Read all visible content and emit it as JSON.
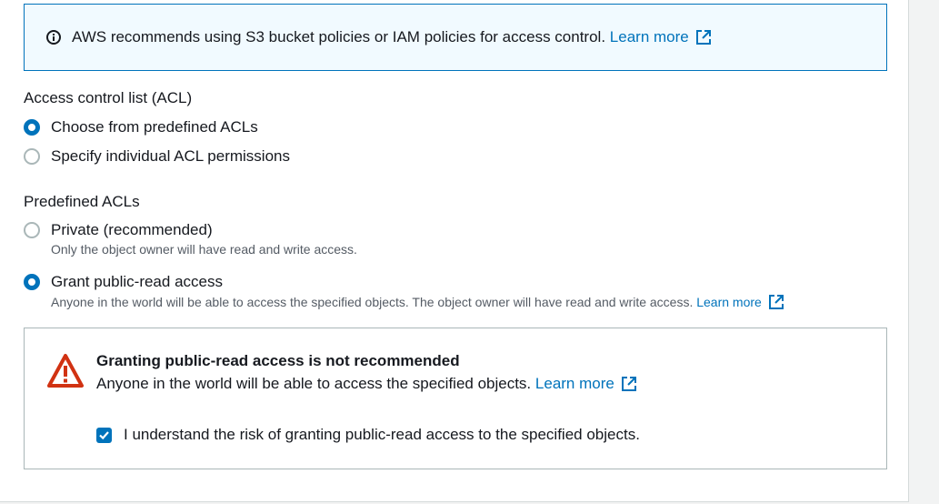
{
  "info_banner": {
    "text": "AWS recommends using S3 bucket policies or IAM policies for access control.",
    "link": "Learn more"
  },
  "acl": {
    "label": "Access control list (ACL)",
    "options": [
      {
        "label": "Choose from predefined ACLs",
        "selected": true
      },
      {
        "label": "Specify individual ACL permissions",
        "selected": false
      }
    ]
  },
  "predefined": {
    "label": "Predefined ACLs",
    "options": [
      {
        "label": "Private (recommended)",
        "description": "Only the object owner will have read and write access.",
        "selected": false
      },
      {
        "label": "Grant public-read access",
        "description": "Anyone in the world will be able to access the specified objects. The object owner will have read and write access.",
        "link": "Learn more",
        "selected": true
      }
    ]
  },
  "warning": {
    "title": "Granting public-read access is not recommended",
    "text": "Anyone in the world will be able to access the specified objects.",
    "link": "Learn more",
    "checkbox_label": "I understand the risk of granting public-read access to the specified objects.",
    "checkbox_checked": true
  },
  "colors": {
    "accent": "#0073bb",
    "warning": "#d13212",
    "info_bg": "#f1faff"
  }
}
